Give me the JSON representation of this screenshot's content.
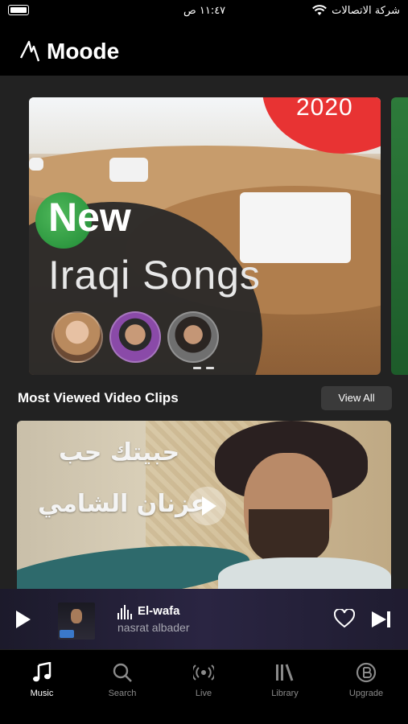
{
  "status_bar": {
    "carrier": "شركة الاتصالات",
    "time": "١١:٤٧ ص"
  },
  "header": {
    "app_name": "Moode"
  },
  "banner": {
    "badge_year": "2020",
    "headline_new": "New",
    "headline_title": "Iraqi Songs"
  },
  "section": {
    "title": "Most Viewed Video Clips",
    "view_all_label": "View All"
  },
  "video_card": {
    "overlay_line1": "حبيتك حب",
    "overlay_line2": "عزنان الشامي"
  },
  "now_playing": {
    "track_title": "El-wafa",
    "artist": "nasrat albader"
  },
  "bottom_nav": {
    "items": [
      {
        "label": "Music",
        "icon": "music-note-icon",
        "active": true
      },
      {
        "label": "Search",
        "icon": "search-icon",
        "active": false
      },
      {
        "label": "Live",
        "icon": "live-broadcast-icon",
        "active": false
      },
      {
        "label": "Library",
        "icon": "library-icon",
        "active": false
      },
      {
        "label": "Upgrade",
        "icon": "upgrade-badge-icon",
        "active": false
      }
    ]
  },
  "colors": {
    "background": "#222222",
    "header_bg": "#000000",
    "accent_red": "#e83333",
    "accent_green": "#2a9a3e",
    "player_bg": "#2a2542"
  }
}
